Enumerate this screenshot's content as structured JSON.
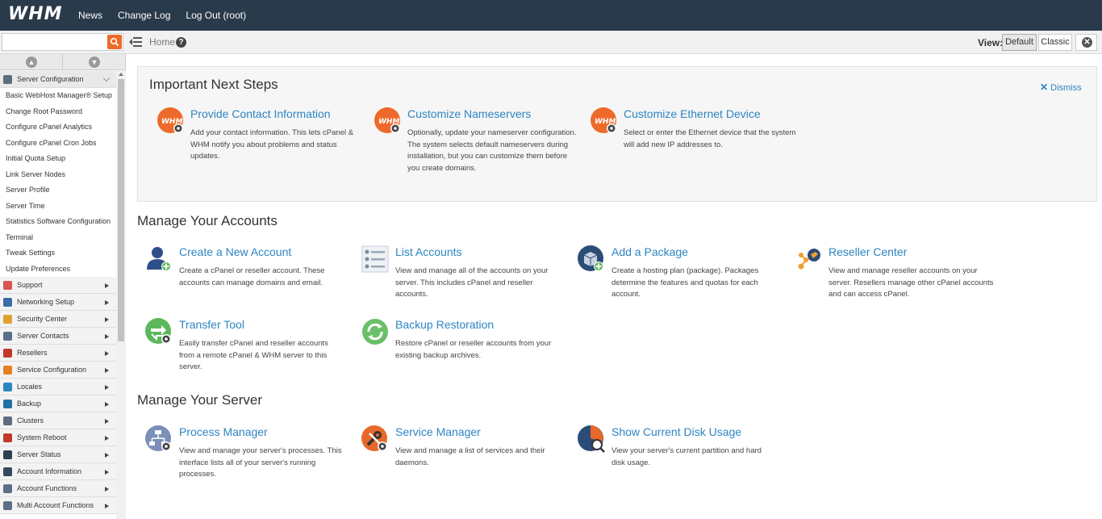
{
  "topbar": {
    "logo": "WHM",
    "links": [
      "News",
      "Change Log",
      "Log Out (root)"
    ]
  },
  "subbar": {
    "search_value": "",
    "breadcrumb": "Home",
    "view_label": "View:",
    "view_default": "Default",
    "view_classic": "Classic"
  },
  "sidebar": {
    "open_category": "Server Configuration",
    "sub_items": [
      "Basic WebHost Manager® Setup",
      "Change Root Password",
      "Configure cPanel Analytics",
      "Configure cPanel Cron Jobs",
      "Initial Quota Setup",
      "Link Server Nodes",
      "Server Profile",
      "Server Time",
      "Statistics Software Configuration",
      "Terminal",
      "Tweak Settings",
      "Update Preferences"
    ],
    "categories": [
      {
        "label": "Support",
        "icon": "support-icon",
        "color": "#d9534f"
      },
      {
        "label": "Networking Setup",
        "icon": "networking-icon",
        "color": "#3a6ea5"
      },
      {
        "label": "Security Center",
        "icon": "lock-icon",
        "color": "#e0a030"
      },
      {
        "label": "Server Contacts",
        "icon": "contacts-icon",
        "color": "#5a6f8a"
      },
      {
        "label": "Resellers",
        "icon": "resellers-icon",
        "color": "#c0392b"
      },
      {
        "label": "Service Configuration",
        "icon": "service-icon",
        "color": "#e67e22"
      },
      {
        "label": "Locales",
        "icon": "globe-icon",
        "color": "#2e86c1"
      },
      {
        "label": "Backup",
        "icon": "backup-icon",
        "color": "#2471a3"
      },
      {
        "label": "Clusters",
        "icon": "clusters-icon",
        "color": "#5d6d7e"
      },
      {
        "label": "System Reboot",
        "icon": "power-icon",
        "color": "#c0392b"
      },
      {
        "label": "Server Status",
        "icon": "monitor-icon",
        "color": "#2e4053"
      },
      {
        "label": "Account Information",
        "icon": "account-info-icon",
        "color": "#34495e"
      },
      {
        "label": "Account Functions",
        "icon": "account-functions-icon",
        "color": "#5b6f85"
      },
      {
        "label": "Multi Account Functions",
        "icon": "multi-account-icon",
        "color": "#5b6f85"
      }
    ]
  },
  "next_steps": {
    "title": "Important Next Steps",
    "dismiss": "Dismiss",
    "items": [
      {
        "title": "Provide Contact Information",
        "desc": "Add your contact information. This lets cPanel & WHM notify you about problems and status updates."
      },
      {
        "title": "Customize Nameservers",
        "desc": "Optionally, update your nameserver configuration. The system selects default nameservers during installation, but you can customize them before you create domains."
      },
      {
        "title": "Customize Ethernet Device",
        "desc": "Select or enter the Ethernet device that the system will add new IP addresses to."
      }
    ]
  },
  "accounts": {
    "title": "Manage Your Accounts",
    "tools": [
      {
        "title": "Create a New Account",
        "desc": "Create a cPanel or reseller account. These accounts can manage domains and email."
      },
      {
        "title": "List Accounts",
        "desc": "View and manage all of the accounts on your server. This includes cPanel and reseller accounts."
      },
      {
        "title": "Add a Package",
        "desc": "Create a hosting plan (package). Packages determine the features and quotas for each account."
      },
      {
        "title": "Reseller Center",
        "desc": "View and manage reseller accounts on your server. Resellers manage other cPanel accounts and can access cPanel."
      },
      {
        "title": "Transfer Tool",
        "desc": "Easily transfer cPanel and reseller accounts from a remote cPanel & WHM server to this server."
      },
      {
        "title": "Backup Restoration",
        "desc": "Restore cPanel or reseller accounts from your existing backup archives."
      }
    ]
  },
  "server": {
    "title": "Manage Your Server",
    "tools": [
      {
        "title": "Process Manager",
        "desc": "View and manage your server's processes. This interface lists all of your server's running processes."
      },
      {
        "title": "Service Manager",
        "desc": "View and manage a list of services and their daemons."
      },
      {
        "title": "Show Current Disk Usage",
        "desc": "View your server's current partition and hard disk usage."
      }
    ]
  },
  "colors": {
    "topbar": "#293a4a",
    "link": "#2d85c2",
    "accent": "#ee6a2a"
  }
}
